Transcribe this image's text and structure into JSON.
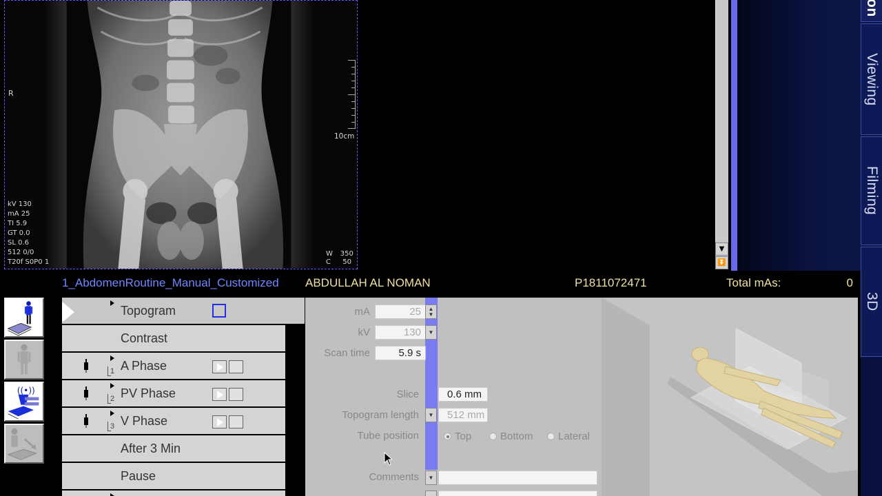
{
  "viewport": {
    "orientation_marker": "R",
    "params": [
      "kV 130",
      "mA 25",
      "TI 5.9",
      "GT 0.0",
      "SL 0.6",
      "512 0/0",
      "T20f S0P0  1"
    ],
    "scale_label": "10cm",
    "window_label": "W",
    "window_value": "350",
    "center_label": "C",
    "center_value": "50"
  },
  "tabs": {
    "top": "on",
    "viewing": "Viewing",
    "filming": "Filming",
    "three_d": "3D"
  },
  "status": {
    "protocol": "1_AbdomenRoutine_Manual_Customized",
    "patient_name": "ABDULLAH AL NOMAN",
    "patient_id": "P1811072471",
    "total_mas_label": "Total mAs:",
    "total_mas_value": "0"
  },
  "scanlist": {
    "rows": [
      {
        "label": "Topogram"
      },
      {
        "label": "Contrast"
      },
      {
        "label": "A Phase",
        "index": "1"
      },
      {
        "label": "PV Phase",
        "index": "2"
      },
      {
        "label": "V Phase",
        "index": "3"
      },
      {
        "label": "After 3 Min"
      },
      {
        "label": "Pause"
      }
    ]
  },
  "params": {
    "ma_label": "mA",
    "ma_value": "25",
    "kv_label": "kV",
    "kv_value": "130",
    "scan_time_label": "Scan time",
    "scan_time_value": "5.9 s",
    "slice_label": "Slice",
    "slice_value": "0.6 mm",
    "topogram_length_label": "Topogram length",
    "topogram_length_value": "512 mm",
    "tube_position_label": "Tube position",
    "tube_options": [
      "Top",
      "Bottom",
      "Lateral"
    ],
    "tube_selected": "Top",
    "comments_label": "Comments",
    "comments_value": ""
  },
  "colors": {
    "accent_blue": "#7b7bf0",
    "protocol_text": "#6f86ff",
    "patient_text": "#ece0a0",
    "panel_gray": "#c0c0c0"
  }
}
